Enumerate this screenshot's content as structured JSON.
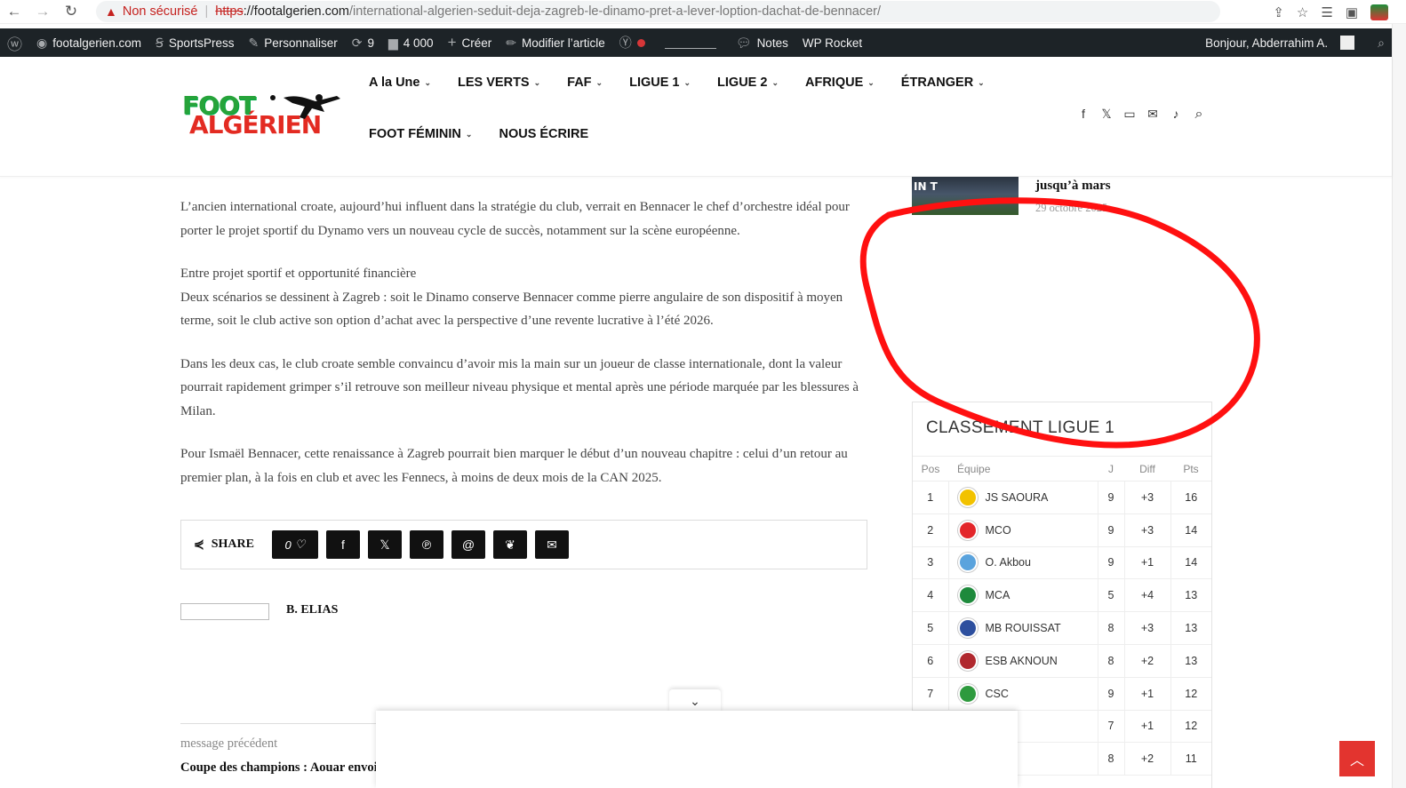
{
  "browser": {
    "not_secure": "Non sécurisé",
    "url_https": "https",
    "url_host": "://footalgerien.com",
    "url_path": "/international-algerien-seduit-deja-zagreb-le-dinamo-pret-a-lever-loption-dachat-de-bennacer/"
  },
  "adminbar": {
    "site": "footalgerien.com",
    "sportspress": "SportsPress",
    "customize": "Personnaliser",
    "updates": "9",
    "comments": "4 000",
    "new": "Créer",
    "edit": "Modifier l’article",
    "notes": "Notes",
    "rocket": "WP Rocket",
    "greeting": "Bonjour, Abderrahim A."
  },
  "logo": {
    "line1": "FOOT",
    "line2": "ALGÉRIEN"
  },
  "menu": {
    "row1": [
      "A la Une",
      "LES VERTS",
      "FAF",
      "LIGUE 1",
      "LIGUE 2",
      "AFRIQUE",
      "ÉTRANGER"
    ],
    "row2": [
      "FOOT FÉMININ",
      "NOUS ÉCRIRE"
    ]
  },
  "article": {
    "p1": "L’ancien international croate, aujourd’hui influent dans la stratégie du club, verrait en Bennacer le chef d’orchestre idéal pour porter le projet sportif du Dynamo vers un nouveau cycle de succès, notamment sur la scène européenne.",
    "p2_heading": "Entre projet sportif et opportunité financière",
    "p2": "Deux scénarios se dessinent à Zagreb : soit le Dinamo conserve Bennacer comme pierre angulaire de son dispositif à moyen terme, soit le club active son option d’achat avec la perspective d’une revente lucrative à l’été 2026.",
    "p3": "Dans les deux cas, le club croate semble convaincu d’avoir mis la main sur un joueur de classe internationale, dont la valeur pourrait rapidement grimper s’il retrouve son meilleur niveau physique et mental après une période marquée par les blessures à Milan.",
    "p4": "Pour Ismaël Bennacer, cette renaissance à Zagreb pourrait bien marquer le début d’un nouveau chapitre : celui d’un retour au premier plan, à la fois en club et avec les Fennecs, à moins de deux mois de la CAN 2025."
  },
  "share": {
    "label": "SHARE",
    "likes": "0"
  },
  "author": {
    "name": "B. ELIAS"
  },
  "prev": {
    "label": "message précédent",
    "title": "Coupe des champions : Aouar envoie Al-Ittihad en quarts de finale (vidéo)"
  },
  "sidebar": {
    "thumb_text": "IN T",
    "post_title": "jusqu’à mars",
    "post_date": "29 octobre 2025"
  },
  "standings": {
    "title": "CLASSEMENT LIGUE 1",
    "headers": [
      "Pos",
      "Équipe",
      "J",
      "Diff",
      "Pts"
    ],
    "rows": [
      {
        "pos": "1",
        "team": "JS SAOURA",
        "j": "9",
        "diff": "+3",
        "pts": "16",
        "color": "#f2c200"
      },
      {
        "pos": "2",
        "team": "MCO",
        "j": "9",
        "diff": "+3",
        "pts": "14",
        "color": "#e3262a"
      },
      {
        "pos": "3",
        "team": "O. Akbou",
        "j": "9",
        "diff": "+1",
        "pts": "14",
        "color": "#5aa3dd"
      },
      {
        "pos": "4",
        "team": "MCA",
        "j": "5",
        "diff": "+4",
        "pts": "13",
        "color": "#1e8a3c"
      },
      {
        "pos": "5",
        "team": "MB ROUISSAT",
        "j": "8",
        "diff": "+3",
        "pts": "13",
        "color": "#2d4f9e"
      },
      {
        "pos": "6",
        "team": "ESB AKNOUN",
        "j": "8",
        "diff": "+2",
        "pts": "13",
        "color": "#b0282e"
      },
      {
        "pos": "7",
        "team": "CSC",
        "j": "9",
        "diff": "+1",
        "pts": "12",
        "color": "#2e9a3e"
      },
      {
        "pos": "",
        "team": "",
        "j": "7",
        "diff": "+1",
        "pts": "12",
        "color": ""
      },
      {
        "pos": "",
        "team": "",
        "j": "8",
        "diff": "+2",
        "pts": "11",
        "color": ""
      }
    ]
  },
  "colors": {
    "accent_red": "#e3342f",
    "admin_bg": "#1d2327",
    "annotation": "#ff1010"
  }
}
